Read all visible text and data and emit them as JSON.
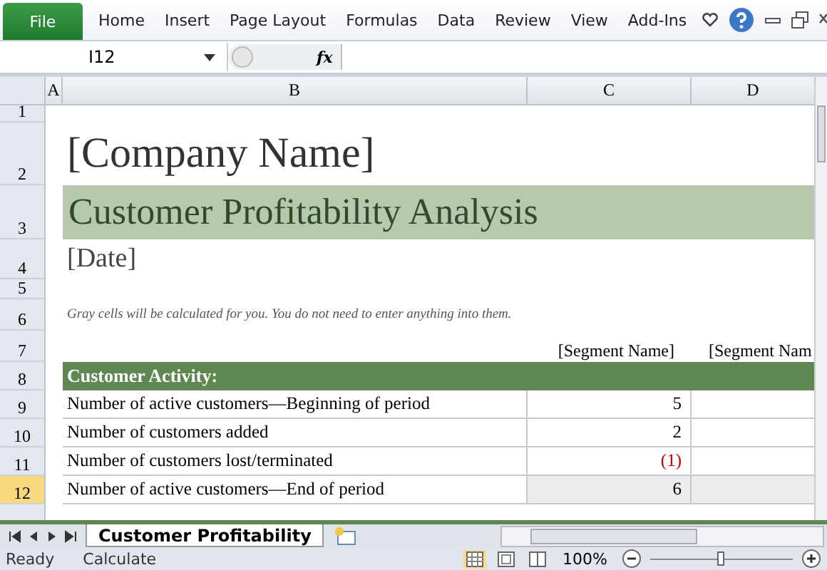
{
  "ribbon": {
    "file_tab": "File",
    "tabs": [
      {
        "label": "Home",
        "selected": false
      },
      {
        "label": "Insert",
        "selected": false
      },
      {
        "label": "Page Layout",
        "selected": false
      },
      {
        "label": "Formulas",
        "selected": false
      },
      {
        "label": "Data",
        "selected": false
      },
      {
        "label": "Review",
        "selected": false
      },
      {
        "label": "View",
        "selected": false
      },
      {
        "label": "Add-Ins",
        "selected": false
      }
    ]
  },
  "formula_bar": {
    "name_box": "I12",
    "function_label": "fx"
  },
  "columns": [
    {
      "label": "A",
      "selected": false
    },
    {
      "label": "B",
      "selected": false
    },
    {
      "label": "C",
      "selected": false
    },
    {
      "label": "D",
      "selected": false
    }
  ],
  "rows": [
    {
      "number": "1",
      "selected": false,
      "kind": "blank"
    },
    {
      "number": "2",
      "selected": false,
      "kind": "company",
      "text": "[Company Name]"
    },
    {
      "number": "3",
      "selected": false,
      "kind": "title",
      "text": "Customer Profitability Analysis"
    },
    {
      "number": "4",
      "selected": false,
      "kind": "date",
      "text": "[Date]"
    },
    {
      "number": "5",
      "selected": false,
      "kind": "blank"
    },
    {
      "number": "6",
      "selected": false,
      "kind": "note",
      "text": "Gray cells will be calculated for you. You do not need to enter anything into them."
    },
    {
      "number": "7",
      "selected": false,
      "kind": "segments",
      "segments": [
        "[Segment Name]",
        "[Segment Nam"
      ]
    },
    {
      "number": "8",
      "selected": false,
      "kind": "section",
      "text": "Customer Activity:"
    },
    {
      "number": "9",
      "selected": false,
      "kind": "data",
      "text": "Number of active customers—Beginning of period",
      "value": "5",
      "negative": false,
      "calculated": false
    },
    {
      "number": "10",
      "selected": false,
      "kind": "data",
      "text": "Number of customers added",
      "value": "2",
      "negative": false,
      "calculated": false
    },
    {
      "number": "11",
      "selected": false,
      "kind": "data",
      "text": "Number of customers lost/terminated",
      "value": "(1)",
      "negative": true,
      "calculated": false
    },
    {
      "number": "12",
      "selected": true,
      "kind": "data",
      "text": "Number of active customers—End of period",
      "value": "6",
      "negative": false,
      "calculated": true
    }
  ],
  "sheet_tabs": [
    {
      "label": "Customer Profitability",
      "selected": true
    }
  ],
  "status_bar": {
    "items": [
      "Ready",
      "Calculate"
    ],
    "views": [
      {
        "selected": true
      },
      {
        "selected": false
      },
      {
        "selected": false
      }
    ],
    "zoom": "100%",
    "zoom_slider": {
      "level": 0.5
    }
  }
}
